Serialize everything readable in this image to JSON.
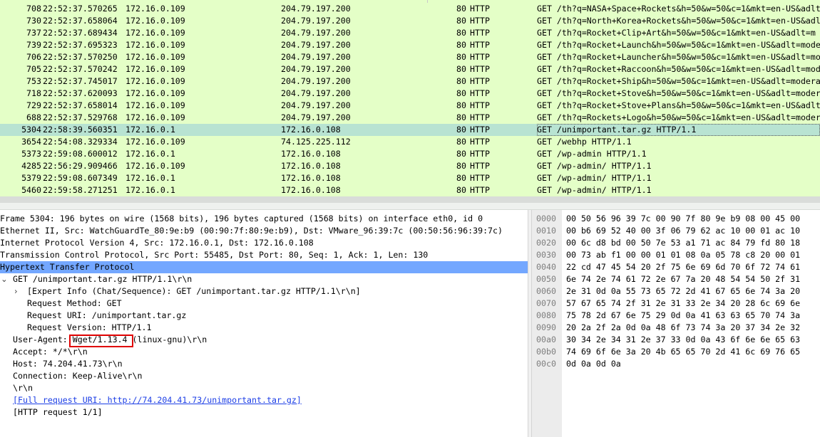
{
  "packet_list": {
    "rows": [
      {
        "no": "708",
        "time": "22:52:37.570265",
        "src": "172.16.0.109",
        "dst": "204.79.197.200",
        "port": "80",
        "proto": "HTTP",
        "info": "GET /th?q=NASA+Space+Rockets&h=50&w=50&c=1&mkt=en-US&adlt",
        "selected": false
      },
      {
        "no": "730",
        "time": "22:52:37.658064",
        "src": "172.16.0.109",
        "dst": "204.79.197.200",
        "port": "80",
        "proto": "HTTP",
        "info": "GET /th?q=North+Korea+Rockets&h=50&w=50&c=1&mkt=en-US&adl",
        "selected": false
      },
      {
        "no": "737",
        "time": "22:52:37.689434",
        "src": "172.16.0.109",
        "dst": "204.79.197.200",
        "port": "80",
        "proto": "HTTP",
        "info": "GET /th?q=Rocket+Clip+Art&h=50&w=50&c=1&mkt=en-US&adlt=m",
        "selected": false
      },
      {
        "no": "739",
        "time": "22:52:37.695323",
        "src": "172.16.0.109",
        "dst": "204.79.197.200",
        "port": "80",
        "proto": "HTTP",
        "info": "GET /th?q=Rocket+Launch&h=50&w=50&c=1&mkt=en-US&adlt=mode",
        "selected": false
      },
      {
        "no": "706",
        "time": "22:52:37.570250",
        "src": "172.16.0.109",
        "dst": "204.79.197.200",
        "port": "80",
        "proto": "HTTP",
        "info": "GET /th?q=Rocket+Launcher&h=50&w=50&c=1&mkt=en-US&adlt=mo",
        "selected": false
      },
      {
        "no": "705",
        "time": "22:52:37.570242",
        "src": "172.16.0.109",
        "dst": "204.79.197.200",
        "port": "80",
        "proto": "HTTP",
        "info": "GET /th?q=Rocket+Raccoon&h=50&w=50&c=1&mkt=en-US&adlt=mod",
        "selected": false
      },
      {
        "no": "753",
        "time": "22:52:37.745017",
        "src": "172.16.0.109",
        "dst": "204.79.197.200",
        "port": "80",
        "proto": "HTTP",
        "info": "GET /th?q=Rocket+Ship&h=50&w=50&c=1&mkt=en-US&adlt=modera",
        "selected": false
      },
      {
        "no": "718",
        "time": "22:52:37.620093",
        "src": "172.16.0.109",
        "dst": "204.79.197.200",
        "port": "80",
        "proto": "HTTP",
        "info": "GET /th?q=Rocket+Stove&h=50&w=50&c=1&mkt=en-US&adlt=moder",
        "selected": false
      },
      {
        "no": "729",
        "time": "22:52:37.658014",
        "src": "172.16.0.109",
        "dst": "204.79.197.200",
        "port": "80",
        "proto": "HTTP",
        "info": "GET /th?q=Rocket+Stove+Plans&h=50&w=50&c=1&mkt=en-US&adlt",
        "selected": false
      },
      {
        "no": "688",
        "time": "22:52:37.529768",
        "src": "172.16.0.109",
        "dst": "204.79.197.200",
        "port": "80",
        "proto": "HTTP",
        "info": "GET /th?q=Rockets+Logo&h=50&w=50&c=1&mkt=en-US&adlt=moder",
        "selected": false
      },
      {
        "no": "5304",
        "time": "22:58:39.560351",
        "src": "172.16.0.1",
        "dst": "172.16.0.108",
        "port": "80",
        "proto": "HTTP",
        "info": "GET /unimportant.tar.gz HTTP/1.1",
        "selected": true
      },
      {
        "no": "3654",
        "time": "22:54:08.329334",
        "src": "172.16.0.109",
        "dst": "74.125.225.112",
        "port": "80",
        "proto": "HTTP",
        "info": "GET /webhp HTTP/1.1",
        "selected": false
      },
      {
        "no": "5373",
        "time": "22:59:08.600012",
        "src": "172.16.0.1",
        "dst": "172.16.0.108",
        "port": "80",
        "proto": "HTTP",
        "info": "GET /wp-admin HTTP/1.1",
        "selected": false
      },
      {
        "no": "4285",
        "time": "22:56:29.909466",
        "src": "172.16.0.109",
        "dst": "172.16.0.108",
        "port": "80",
        "proto": "HTTP",
        "info": "GET /wp-admin/ HTTP/1.1",
        "selected": false
      },
      {
        "no": "5379",
        "time": "22:59:08.607349",
        "src": "172.16.0.1",
        "dst": "172.16.0.108",
        "port": "80",
        "proto": "HTTP",
        "info": "GET /wp-admin/ HTTP/1.1",
        "selected": false
      },
      {
        "no": "5460",
        "time": "22:59:58.271251",
        "src": "172.16.0.1",
        "dst": "172.16.0.108",
        "port": "80",
        "proto": "HTTP",
        "info": "GET /wp-admin/ HTTP/1.1",
        "selected": false
      }
    ]
  },
  "details": {
    "rows": [
      {
        "text": "Frame 5304: 196 bytes on wire (1568 bits), 196 bytes captured (1568 bits) on interface eth0, id 0",
        "arrow": "",
        "level": 0,
        "highlight": false,
        "link": false
      },
      {
        "text": "Ethernet II, Src: WatchGuardTe_80:9e:b9 (00:90:7f:80:9e:b9), Dst: VMware_96:39:7c (00:50:56:96:39:7c)",
        "arrow": "",
        "level": 0,
        "highlight": false,
        "link": false
      },
      {
        "text": "Internet Protocol Version 4, Src: 172.16.0.1, Dst: 172.16.0.108",
        "arrow": "",
        "level": 0,
        "highlight": false,
        "link": false
      },
      {
        "text": "Transmission Control Protocol, Src Port: 55485, Dst Port: 80, Seq: 1, Ack: 1, Len: 130",
        "arrow": "",
        "level": 0,
        "highlight": false,
        "link": false
      },
      {
        "text": "Hypertext Transfer Protocol",
        "arrow": "",
        "level": 0,
        "highlight": true,
        "link": false
      },
      {
        "text": "GET /unimportant.tar.gz HTTP/1.1\\r\\n",
        "arrow": "⌄",
        "level": 1,
        "highlight": false,
        "link": false
      },
      {
        "text": "[Expert Info (Chat/Sequence): GET /unimportant.tar.gz HTTP/1.1\\r\\n]",
        "arrow": "›",
        "level": 2,
        "highlight": false,
        "link": false
      },
      {
        "text": "Request Method: GET",
        "arrow": "",
        "level": 2,
        "highlight": false,
        "link": false
      },
      {
        "text": "Request URI: /unimportant.tar.gz",
        "arrow": "",
        "level": 2,
        "highlight": false,
        "link": false
      },
      {
        "text": "Request Version: HTTP/1.1",
        "arrow": "",
        "level": 2,
        "highlight": false,
        "link": false
      },
      {
        "text": "User-Agent: Wget/1.13.4 (linux-gnu)\\r\\n",
        "arrow": "",
        "level": 1,
        "highlight": false,
        "link": false
      },
      {
        "text": "Accept: */*\\r\\n",
        "arrow": "",
        "level": 1,
        "highlight": false,
        "link": false
      },
      {
        "text": "Host: 74.204.41.73\\r\\n",
        "arrow": "",
        "level": 1,
        "highlight": false,
        "link": false
      },
      {
        "text": "Connection: Keep-Alive\\r\\n",
        "arrow": "",
        "level": 1,
        "highlight": false,
        "link": false
      },
      {
        "text": "\\r\\n",
        "arrow": "",
        "level": 1,
        "highlight": false,
        "link": false
      },
      {
        "text": "[Full request URI: http://74.204.41.73/unimportant.tar.gz]",
        "arrow": "",
        "level": 1,
        "highlight": false,
        "link": true
      },
      {
        "text": "[HTTP request 1/1]",
        "arrow": "",
        "level": 1,
        "highlight": false,
        "link": false
      }
    ]
  },
  "bytes": {
    "rows": [
      {
        "offset": "0000",
        "hex": "00 50 56 96 39 7c 00 90  7f 80 9e b9 08 00 45 00"
      },
      {
        "offset": "0010",
        "hex": "00 b6 69 52 40 00 3f 06  79 62 ac 10 00 01 ac 10"
      },
      {
        "offset": "0020",
        "hex": "00 6c d8 bd 00 50 7e 53  a1 71 ac 84 79 fd 80 18"
      },
      {
        "offset": "0030",
        "hex": "00 73 ab f1 00 00 01 01  08 0a 05 78 c8 20 00 01"
      },
      {
        "offset": "0040",
        "hex": "22 cd 47 45 54 20 2f 75  6e 69 6d 70 6f 72 74 61"
      },
      {
        "offset": "0050",
        "hex": "6e 74 2e 74 61 72 2e 67  7a 20 48 54 54 50 2f 31"
      },
      {
        "offset": "0060",
        "hex": "2e 31 0d 0a 55 73 65 72  2d 41 67 65 6e 74 3a 20"
      },
      {
        "offset": "0070",
        "hex": "57 67 65 74 2f 31 2e 31  33 2e 34 20 28 6c 69 6e"
      },
      {
        "offset": "0080",
        "hex": "75 78 2d 67 6e 75 29 0d  0a 41 63 63 65 70 74 3a"
      },
      {
        "offset": "0090",
        "hex": "20 2a 2f 2a 0d 0a 48 6f  73 74 3a 20 37 34 2e 32"
      },
      {
        "offset": "00a0",
        "hex": "30 34 2e 34 31 2e 37 33  0d 0a 43 6f 6e 6e 65 63"
      },
      {
        "offset": "00b0",
        "hex": "74 69 6f 6e 3a 20 4b 65  65 70 2d 41 6c 69 76 65"
      },
      {
        "offset": "00c0",
        "hex": "0d 0a 0d 0a"
      }
    ]
  },
  "colors": {
    "http_row": "#e4ffc7",
    "selected_row": "#b8e3d2",
    "tree_highlight": "#73a7ff",
    "annotation_box": "#e00000",
    "link": "#1c3ee6"
  }
}
